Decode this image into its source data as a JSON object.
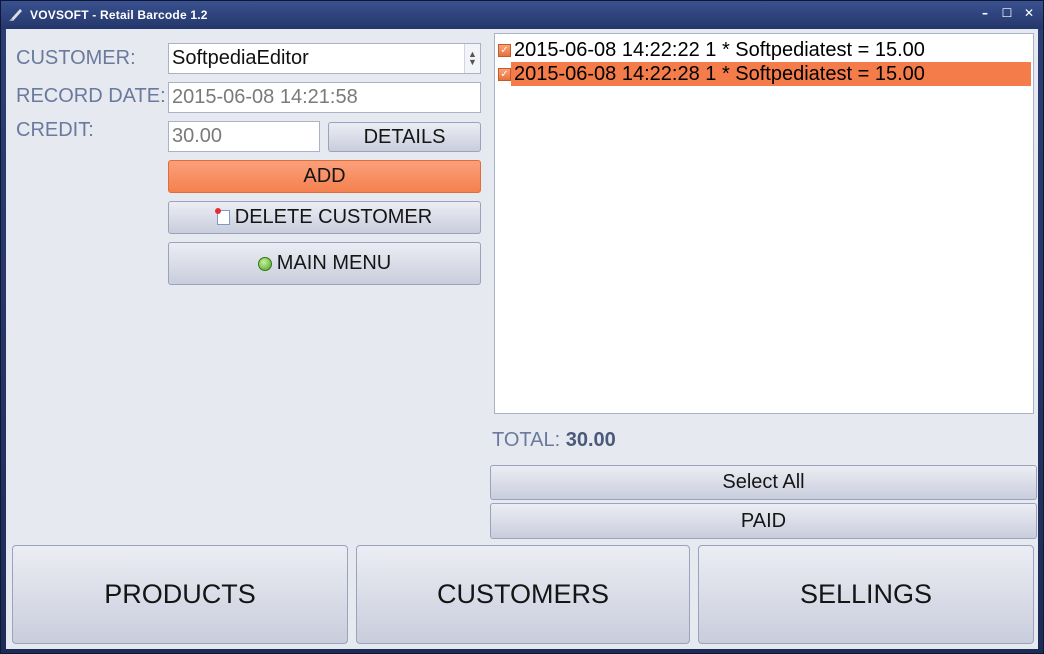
{
  "window": {
    "title": "VOVSOFT - Retail Barcode 1.2",
    "controls": {
      "minimize": "–",
      "maximize": "☐",
      "close": "✕"
    }
  },
  "form": {
    "customer_label": "CUSTOMER:",
    "customer_value": "SoftpediaEditor",
    "record_date_label": "RECORD DATE:",
    "record_date_value": "2015-06-08 14:21:58",
    "credit_label": "CREDIT:",
    "credit_value": "30.00"
  },
  "buttons": {
    "details": "DETAILS",
    "add": "ADD",
    "delete_customer": "DELETE CUSTOMER",
    "main_menu": "MAIN MENU",
    "select_all": "Select All",
    "paid": "PAID"
  },
  "records": [
    {
      "text": "2015-06-08 14:22:22 1 * Softpediatest = 15.00",
      "checked": true,
      "selected": false
    },
    {
      "text": "2015-06-08 14:22:28 1 * Softpediatest = 15.00",
      "checked": true,
      "selected": true
    }
  ],
  "total": {
    "label": "TOTAL:",
    "value": "30.00"
  },
  "nav": {
    "products": "PRODUCTS",
    "customers": "CUSTOMERS",
    "sellings": "SELLINGS"
  },
  "colors": {
    "accent": "#f4814f",
    "selection": "#f47c4a",
    "title_bar": "#2c3f74",
    "label_text": "#6a7a9c"
  }
}
